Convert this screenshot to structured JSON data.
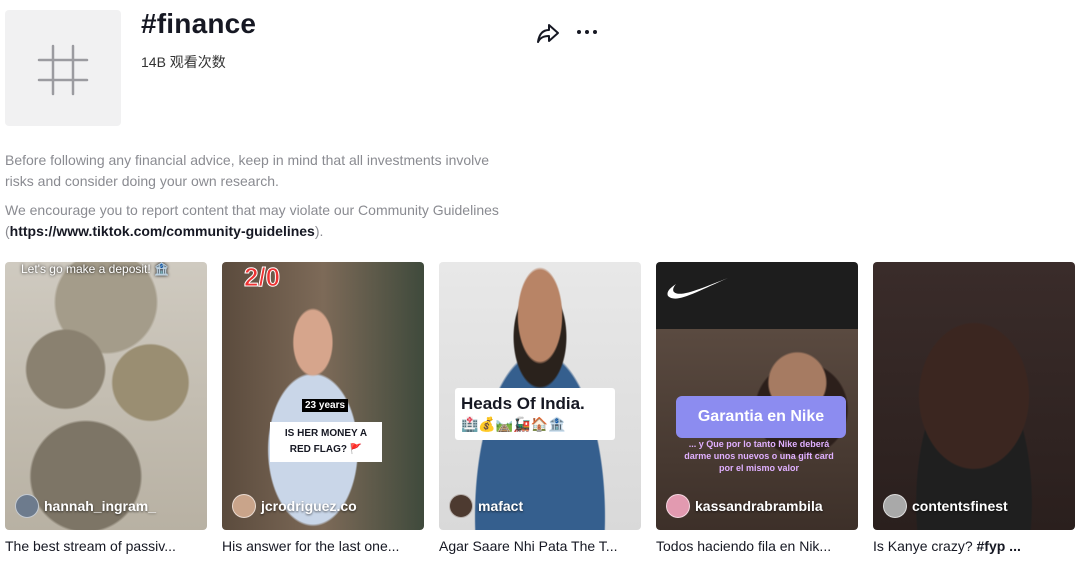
{
  "tag": {
    "title": "#finance",
    "views": "14B 观看次数"
  },
  "description": {
    "para1": "Before following any financial advice, keep in mind that all investments involve risks and consider doing your own research.",
    "para2_before": "We encourage you to report content that may violate our Community Guidelines (",
    "para2_link": "https://www.tiktok.com/community-guidelines",
    "para2_after": ")."
  },
  "videos": [
    {
      "author": "hannah_ingram_",
      "caption": "The best stream of passiv...",
      "overlay": "Let's go make a deposit! 🏦"
    },
    {
      "author": "jcrodriguez.co",
      "caption": "His answer for the last one...",
      "overlay_score": "2/0",
      "overlay_age": "23 years",
      "overlay_question": "IS HER MONEY A RED FLAG? 🚩"
    },
    {
      "author": "mafact",
      "caption": "Agar Saare Nhi Pata The T...",
      "overlay": "Heads Of India."
    },
    {
      "author": "kassandrabrambila",
      "caption": "Todos haciendo fila en Nik...",
      "overlay": "Garantia en Nike",
      "overlay_sub": "... y Que por lo tanto Nike deberá darme unos nuevos o una gift card por el mismo valor"
    },
    {
      "author": "contentsfinest",
      "caption_text": "Is Kanye crazy? ",
      "caption_tag": "#fyp ..."
    }
  ],
  "colors": {
    "text": "#161823",
    "muted": "#8a8b91",
    "nike_bubble": "#8c8cf0"
  }
}
